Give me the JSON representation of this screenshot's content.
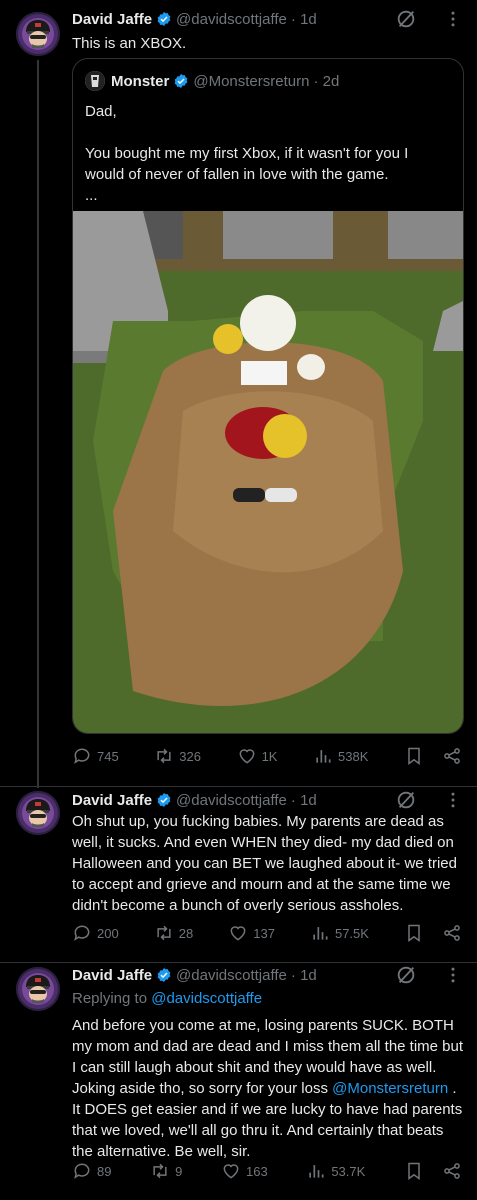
{
  "tweet1": {
    "name": "David Jaffe",
    "handle": "@davidscottjaffe",
    "time": "· 1d",
    "text": "This is an XBOX.",
    "quote": {
      "name": "Monster",
      "handle": "@Monstersreturn",
      "time": "· 2d",
      "text": "Dad,\n\nYou bought me my first Xbox, if it wasn't for you I would of never of fallen in love with the game.\n...",
      "image_alt": "Grave with flowers, a pumpkin and an Xbox controller"
    },
    "stats": {
      "replies": "745",
      "reposts": "326",
      "likes": "1K",
      "views": "538K"
    }
  },
  "tweet2": {
    "name": "David Jaffe",
    "handle": "@davidscottjaffe",
    "time": "· 1d",
    "text": "Oh shut up, you fucking babies. My parents are dead as well, it sucks. And even WHEN they died- my dad died on Halloween and you can BET we laughed about it- we tried to accept and grieve and mourn and at the same time we didn't become a bunch of overly serious assholes.",
    "stats": {
      "replies": "200",
      "reposts": "28",
      "likes": "137",
      "views": "57.5K"
    }
  },
  "tweet3": {
    "name": "David Jaffe",
    "handle": "@davidscottjaffe",
    "time": "· 1d",
    "replying_prefix": "Replying to ",
    "replying_to": "@davidscottjaffe",
    "text_a": "And before you come at me, losing parents SUCK. BOTH my mom and dad are dead and I miss them all the time but I can still laugh about shit and they would have as well. Joking aside tho, so sorry for your loss ",
    "mention": "@Monstersreturn",
    "text_b": " . It DOES get easier and if we are lucky to have had parents that we loved, we'll all go thru it. And certainly that beats the alternative. Be well, sir.",
    "stats": {
      "replies": "89",
      "reposts": "9",
      "likes": "163",
      "views": "53.7K"
    }
  },
  "colors": {
    "bg": "#000000",
    "text": "#e7e9ea",
    "muted": "#71767b",
    "accent": "#1d9bf0",
    "border": "#2f3336"
  },
  "icons": [
    "verified-badge-icon",
    "grok-icon",
    "more-icon",
    "reply-icon",
    "repost-icon",
    "like-icon",
    "views-icon",
    "bookmark-icon",
    "share-icon"
  ]
}
